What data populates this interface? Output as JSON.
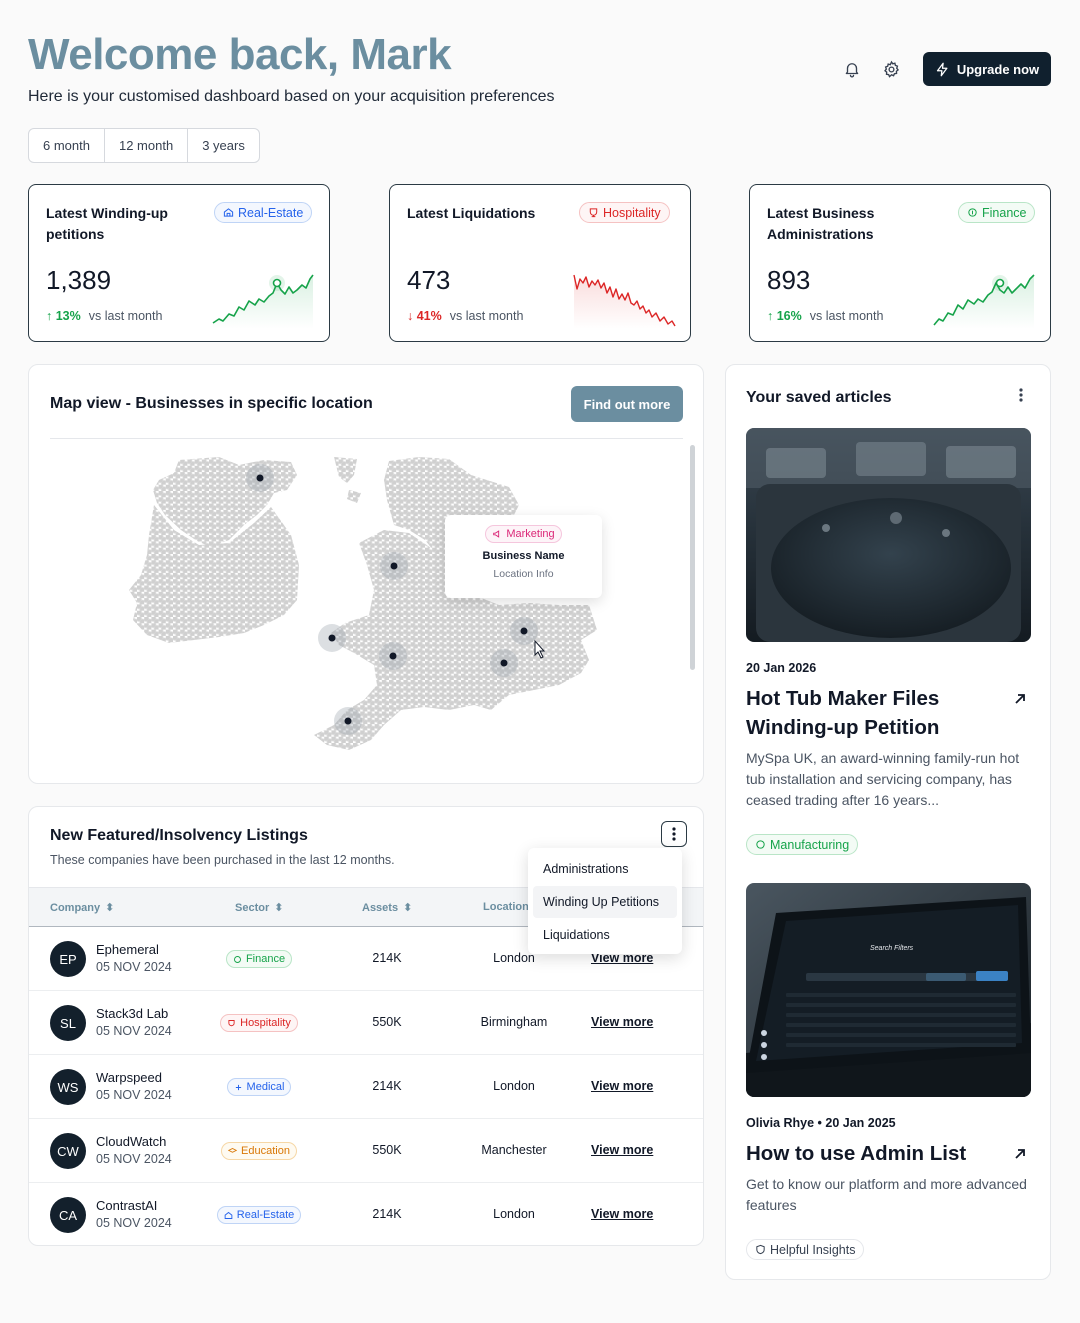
{
  "header": {
    "title": "Welcome back, Mark",
    "subtitle": "Here is your customised dashboard based on your acquisition preferences",
    "upgrade_label": "Upgrade now",
    "bell_icon": "bell-icon",
    "settings_icon": "gear-icon"
  },
  "periods": [
    "6 month",
    "12 month",
    "3 years"
  ],
  "stats": [
    {
      "title": "Latest Winding-up petitions",
      "badge": "Real-Estate",
      "badge_icon": "home-icon",
      "value": "1,389",
      "change": "13%",
      "direction": "up",
      "change_suffix": "vs last month"
    },
    {
      "title": "Latest Liquidations",
      "badge": "Hospitality",
      "badge_icon": "cup-icon",
      "value": "473",
      "change": "41%",
      "direction": "down",
      "change_suffix": "vs last month"
    },
    {
      "title": "Latest Business Administrations",
      "badge": "Finance",
      "badge_icon": "coin-icon",
      "value": "893",
      "change": "16%",
      "direction": "up",
      "change_suffix": "vs last month"
    }
  ],
  "map": {
    "title": "Map view - Businesses in specific location",
    "button": "Find out more",
    "tooltip": {
      "badge": "Marketing",
      "name": "Business Name",
      "info": "Location Info"
    }
  },
  "listings": {
    "title": "New Featured/Insolvency Listings",
    "subtitle": "These companies have been purchased in the last 12 months.",
    "columns": [
      "Company",
      "Sector",
      "Assets",
      "Location"
    ],
    "rows": [
      {
        "initials": "EP",
        "name": "Ephemeral",
        "date": "05 NOV 2024",
        "sector": "Finance",
        "assets": "214K",
        "location": "London",
        "action": "View more"
      },
      {
        "initials": "SL",
        "name": "Stack3d Lab",
        "date": "05 NOV 2024",
        "sector": "Hospitality",
        "assets": "550K",
        "location": "Birmingham",
        "action": "View more"
      },
      {
        "initials": "WS",
        "name": "Warpspeed",
        "date": "05 NOV 2024",
        "sector": "Medical",
        "assets": "214K",
        "location": "London",
        "action": "View more"
      },
      {
        "initials": "CW",
        "name": "CloudWatch",
        "date": "05 NOV 2024",
        "sector": "Education",
        "assets": "550K",
        "location": "Manchester",
        "action": "View more"
      },
      {
        "initials": "CA",
        "name": "ContrastAI",
        "date": "05 NOV 2024",
        "sector": "Real-Estate",
        "assets": "214K",
        "location": "London",
        "action": "View more"
      }
    ],
    "dropdown": [
      "Administrations",
      "Winding Up Petitions",
      "Liquidations"
    ]
  },
  "articles": {
    "title": "Your saved articles",
    "items": [
      {
        "meta": "20 Jan 2026",
        "title": "Hot Tub Maker Files Winding-up Petition",
        "desc": "MySpa UK, an award-winning family-run hot tub installation and servicing company, has ceased trading after 16 years...",
        "tag": "Manufacturing"
      },
      {
        "meta": "Olivia Rhye • 20 Jan 2025",
        "title": "How to use Admin List",
        "desc": "Get to know our platform and more advanced features",
        "tag": "Helpful Insights",
        "screen_title": "Search Filters"
      }
    ]
  },
  "colors": {
    "accent": "#6b8ea0",
    "dark": "#10202e",
    "up": "#16a34a",
    "down": "#dc2626"
  }
}
